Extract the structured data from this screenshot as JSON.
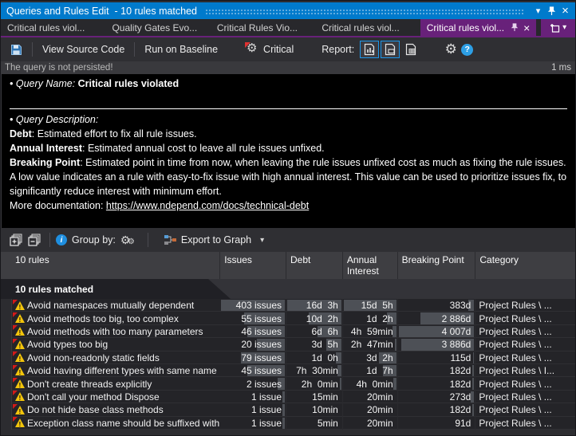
{
  "title_bar": {
    "title": "Queries and Rules Edit ",
    "subtitle": " - 10 rules matched"
  },
  "tabs": {
    "items": [
      {
        "label": "Critical rules viol...",
        "active": false
      },
      {
        "label": "Quality Gates Evo...",
        "active": false
      },
      {
        "label": "Critical Rules Vio...",
        "active": false
      },
      {
        "label": "Critical rules viol...",
        "active": false
      },
      {
        "label": "Critical rules viol...",
        "active": true
      }
    ]
  },
  "toolbar": {
    "view_source_label": "View Source Code",
    "run_baseline_label": "Run on Baseline",
    "critical_label": "Critical",
    "report_label": "Report:"
  },
  "status_bar": {
    "message": "The query is not persisted!",
    "elapsed": "1 ms"
  },
  "description": {
    "query_name_label": "• Query Name: ",
    "query_name": "Critical rules violated",
    "query_description_label": "• Query Description:",
    "paragraphs": [
      {
        "term": "Debt",
        "text": ": Estimated effort to fix all rule issues."
      },
      {
        "term": "Annual Interest",
        "text": ": Estimated annual cost to leave all rule issues unfixed."
      },
      {
        "term": "Breaking Point",
        "text": ": Estimated point in time from now, when leaving the rule issues unfixed cost as much as fixing the rule issues. A low value indicates an a rule with easy-to-fix issue with high annual interest. This value can be used to prioritize issues fix, to significantly reduce interest with minimum effort."
      }
    ],
    "more_doc_label": "More documentation: ",
    "doc_link": "https://www.ndepend.com/docs/technical-debt"
  },
  "grid_toolbar": {
    "group_by_label": "Group by:",
    "export_label": "Export to Graph"
  },
  "grid": {
    "columns": [
      "10 rules",
      "Issues",
      "Debt",
      "Annual Interest",
      "Breaking Point",
      "Category"
    ],
    "group_tab": "10 rules matched",
    "rows": [
      {
        "name": "Avoid namespaces mutually dependent",
        "issues": "403 issues",
        "issues_frac": 1.0,
        "debt": "16d  3h",
        "debt_frac": 1.0,
        "interest": "15d  5h",
        "interest_frac": 1.0,
        "breaking": "383d",
        "breaking_frac": 0.1,
        "category": "Project Rules \\ ..."
      },
      {
        "name": "Avoid methods too big, too complex",
        "issues": "55 issues",
        "issues_frac": 0.65,
        "debt": "10d  2h",
        "debt_frac": 0.62,
        "interest": "1d  2h",
        "interest_frac": 0.2,
        "breaking": "2 886d",
        "breaking_frac": 0.72,
        "category": "Project Rules \\ ..."
      },
      {
        "name": "Avoid methods with too many parameters",
        "issues": "46 issues",
        "issues_frac": 0.6,
        "debt": "6d  6h",
        "debt_frac": 0.45,
        "interest": "4h  59min",
        "interest_frac": 0.1,
        "breaking": "4 007d",
        "breaking_frac": 1.0,
        "category": "Project Rules \\ ..."
      },
      {
        "name": "Avoid types too big",
        "issues": "20 issues",
        "issues_frac": 0.45,
        "debt": "3d  5h",
        "debt_frac": 0.3,
        "interest": "2h  47min",
        "interest_frac": 0.06,
        "breaking": "3 886d",
        "breaking_frac": 0.97,
        "category": "Project Rules \\ ..."
      },
      {
        "name": "Avoid non-readonly static fields",
        "issues": "79 issues",
        "issues_frac": 0.7,
        "debt": "1d  0h",
        "debt_frac": 0.12,
        "interest": "3d  2h",
        "interest_frac": 0.35,
        "breaking": "115d",
        "breaking_frac": 0.03,
        "category": "Project Rules \\ ..."
      },
      {
        "name": "Avoid having different types with same name",
        "issues": "45 issues",
        "issues_frac": 0.6,
        "debt": "7h  30min",
        "debt_frac": 0.1,
        "interest": "1d  7h",
        "interest_frac": 0.28,
        "breaking": "182d",
        "breaking_frac": 0.05,
        "category": "Project Rules \\ I..."
      },
      {
        "name": "Don't create threads explicitly",
        "issues": "2 issues",
        "issues_frac": 0.14,
        "debt": "2h  0min",
        "debt_frac": 0.05,
        "interest": "4h  0min",
        "interest_frac": 0.09,
        "breaking": "182d",
        "breaking_frac": 0.05,
        "category": "Project Rules \\ ..."
      },
      {
        "name": "Don't call your method Dispose",
        "issues": "1 issue",
        "issues_frac": 0.06,
        "debt": "15min",
        "debt_frac": 0.02,
        "interest": "20min",
        "interest_frac": 0.03,
        "breaking": "273d",
        "breaking_frac": 0.07,
        "category": "Project Rules \\ ..."
      },
      {
        "name": "Do not hide base class methods",
        "issues": "1 issue",
        "issues_frac": 0.06,
        "debt": "10min",
        "debt_frac": 0.02,
        "interest": "20min",
        "interest_frac": 0.03,
        "breaking": "182d",
        "breaking_frac": 0.05,
        "category": "Project Rules \\ ..."
      },
      {
        "name": "Exception class name should be suffixed with 'E",
        "issues": "1 issue",
        "issues_frac": 0.06,
        "debt": "5min",
        "debt_frac": 0.01,
        "interest": "20min",
        "interest_frac": 0.03,
        "breaking": "91d",
        "breaking_frac": 0.02,
        "category": "Project Rules \\ ..."
      }
    ]
  },
  "icons": {
    "titlebar": [
      "window-position-caret-icon",
      "pin-icon",
      "close-icon"
    ],
    "toolbar": [
      "save-icon",
      "critical-gear-icon",
      "report-doc-chart-icon",
      "report-doc-export-icon",
      "report-doc-table-icon",
      "settings-gear-icon",
      "help-icon"
    ],
    "grid_toolbar": [
      "expand-all-icon",
      "collapse-all-icon",
      "info-icon",
      "group-by-gears-icon",
      "export-graph-icon",
      "dropdown-caret-icon"
    ],
    "row": [
      "warning-icon"
    ]
  },
  "colors": {
    "titlebar_blue": "#007acc",
    "accent_purple": "#68217a",
    "checked_border_blue": "#1c97ea",
    "warning_yellow": "#f3c50b",
    "warning_flag_red": "#d11a1a",
    "bar_gray": "#4d5056",
    "panel_black": "#000000"
  }
}
